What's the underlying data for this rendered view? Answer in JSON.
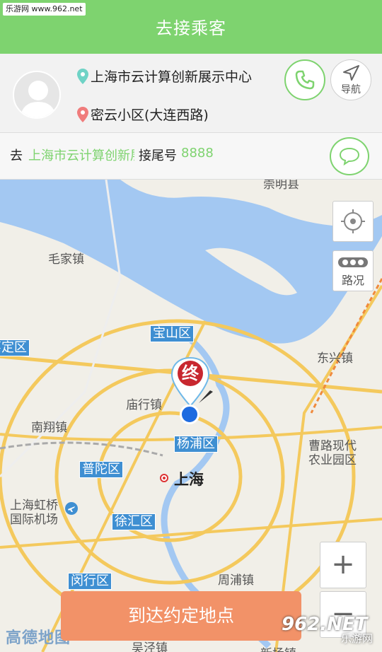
{
  "watermark_top": "乐游网 www.962.net",
  "header": {
    "title": "去接乘客"
  },
  "rider": {
    "origin": "上海市云计算创新展示中心",
    "destination": "密云小区(大连西路)",
    "call_icon": "phone-icon",
    "nav_icon": "navigation-arrow-icon",
    "nav_label": "导航"
  },
  "dest_bar": {
    "prefix": "去",
    "place": "上海市云计算创新展示中心",
    "tail_label": "接尾号",
    "tail_number": "8888",
    "message_icon": "chat-bubble-icon"
  },
  "map": {
    "labels": {
      "chongming": "崇明县",
      "maojia": "毛家镇",
      "baoshan": "宝山区",
      "jiading": "嘉定区",
      "dongxing": "东兴镇",
      "miaohang": "庙行镇",
      "nanxiang": "南翔镇",
      "yangpu": "杨浦区",
      "caolu": "曹路现代",
      "caolu2": "农业园区",
      "putuo": "普陀区",
      "shanghai": "上海",
      "hongqiao": "上海虹桥",
      "hongqiao2": "国际机场",
      "xuhui": "徐汇区",
      "zhoupu": "周浦镇",
      "minhang": "闵行区",
      "wujing": "吴泾镇",
      "xinchang": "新场镇"
    },
    "marker_label": "终",
    "locate_icon": "locate-icon",
    "traffic_label": "路况",
    "traffic_icon": "traffic-light-icon",
    "zoom_in": "+",
    "zoom_out": "−",
    "logo": "高德地图"
  },
  "arrive_button": "到达约定地点",
  "watermark_bottom": {
    "big": "962.NET",
    "small": "乐游网"
  },
  "colors": {
    "accent": "#7ed36f",
    "button": "#f29268",
    "water": "#a3c8f2"
  }
}
